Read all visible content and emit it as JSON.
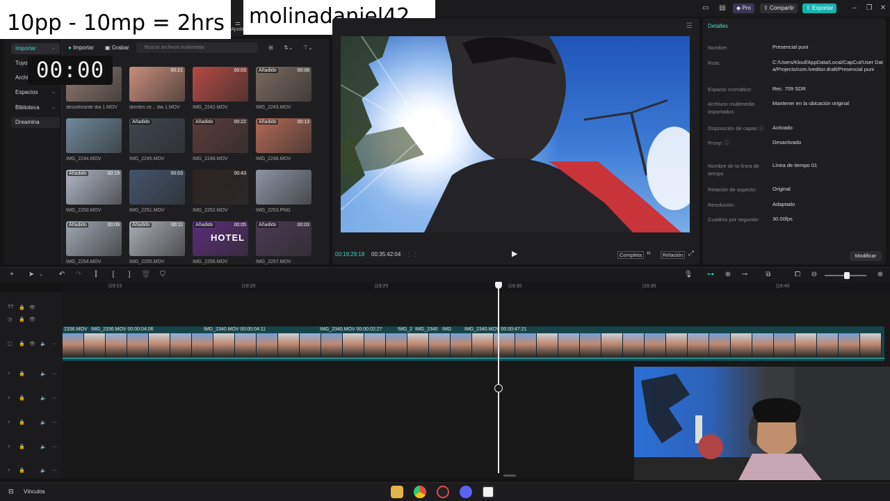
{
  "overlay": {
    "label": "10pp - 10mp = 2hrs",
    "username": "molinadaniel42",
    "timer": "00:00",
    "ajuste_label": "Ajuste"
  },
  "titlebar": {
    "pro_label": "Pro",
    "share_label": "Compartir",
    "export_label": "Exportar"
  },
  "media": {
    "sidebar": [
      {
        "label": "Importar",
        "has_chevron": true
      },
      {
        "label": "Tuyos",
        "has_chevron": false
      },
      {
        "label": "Archivos",
        "has_chevron": false
      },
      {
        "label": "Espacios",
        "has_chevron": true
      },
      {
        "label": "Biblioteca",
        "has_chevron": true
      },
      {
        "label": "Dreamina",
        "has_chevron": false
      }
    ],
    "import_label": "Importar",
    "record_label": "Grabar",
    "search_placeholder": "Buscar archivos multimedia",
    "tiles": [
      {
        "name": "desodorante dia 1.MOV",
        "badge": "",
        "duration": ""
      },
      {
        "name": "dientes ce... dia 1.MOV",
        "badge": "",
        "duration": "00:21"
      },
      {
        "name": "IMG_2242.MOV",
        "badge": "",
        "duration": "00:03"
      },
      {
        "name": "IMG_2243.MOV",
        "badge": "Añadido",
        "duration": "00:08"
      },
      {
        "name": "IMG_2244.MOV",
        "badge": "",
        "duration": ""
      },
      {
        "name": "IMG_2245.MOV",
        "badge": "Añadido",
        "duration": ""
      },
      {
        "name": "IMG_2246.MOV",
        "badge": "Añadido",
        "duration": "00:22"
      },
      {
        "name": "IMG_2248.MOV",
        "badge": "Añadido",
        "duration": "00:13"
      },
      {
        "name": "IMG_2250.MOV",
        "badge": "Añadido",
        "duration": "00:19"
      },
      {
        "name": "IMG_2251.MOV",
        "badge": "",
        "duration": "00:03"
      },
      {
        "name": "IMG_2252.MOV",
        "badge": "",
        "duration": "00:43"
      },
      {
        "name": "IMG_2253.PNG",
        "badge": "",
        "duration": ""
      },
      {
        "name": "IMG_2254.MOV",
        "badge": "Añadido",
        "duration": "00:09"
      },
      {
        "name": "IMG_2255.MOV",
        "badge": "Añadido",
        "duration": "00:11"
      },
      {
        "name": "IMG_2256.MOV",
        "badge": "Añadido",
        "duration": "00:05"
      },
      {
        "name": "IMG_2257.MOV",
        "badge": "Añadido",
        "duration": "00:03"
      }
    ],
    "tile_colors": [
      "#8f7a70",
      "#c98d7a",
      "#b64a44",
      "#7a6a60",
      "#6f8a9a",
      "#3f4650",
      "#5a3c3a",
      "#b26a55",
      "#b0b6c4",
      "#43546a",
      "#2c2422",
      "#8d95a3",
      "#9ea6b0",
      "#a7adb4",
      "#5a2d78",
      "#4a3a52"
    ],
    "hotel_text": "HOTEL"
  },
  "player": {
    "current_time": "00:19:29:18",
    "total_time": "00:35:42:04",
    "full_label": "Completa",
    "ratio_label": "Relación"
  },
  "details": {
    "title": "Detalles",
    "rows": [
      {
        "label": "Nombre:",
        "value": "Presencial puni"
      },
      {
        "label": "Ruta:",
        "value": "C:/Users/Klouf/AppData/Local/CapCut/User Data/Projects/com.lveditor.draft/Presencial puni"
      },
      {
        "label": "Espacio cromático:",
        "value": "Rec. 709 SDR"
      },
      {
        "label": "Archivos multimedia importados:",
        "value": "Mantener en la ubicación original"
      },
      {
        "label": "Disposición de capas ⓘ",
        "value": "Activado"
      },
      {
        "label": "Proxy: ⓘ",
        "value": "Desactivado"
      },
      {
        "label": "Nombre de la línea de tiempo",
        "value": "Línea de tiempo 01"
      },
      {
        "label": "Relación de aspecto:",
        "value": "Original"
      },
      {
        "label": "Resolución:",
        "value": "Adaptado"
      },
      {
        "label": "Cuadros por segundo:",
        "value": "30.00fps"
      }
    ],
    "modify_label": "Modificar"
  },
  "timeline": {
    "ticks": [
      "|19:15",
      "|19:20",
      "|19:25",
      "|19:30",
      "|19:35",
      "|19:40"
    ],
    "clips": [
      {
        "label": "2336.MOV"
      },
      {
        "label": "IMG_2336.MOV  00:00:04:06"
      },
      {
        "label": "IMG_2340.MOV  00:00:04:11"
      },
      {
        "label": "IMG_2340.MOV  00:00:02:27"
      },
      {
        "label": "IMG_2"
      },
      {
        "label": "IMG_2340"
      },
      {
        "label": "IMG"
      },
      {
        "label": "IMG_2340.MOV  00:00:47:21"
      }
    ]
  },
  "taskbar": {
    "item_label": "Vínculos"
  },
  "colors": {
    "accent_teal": "#3ed4c6",
    "export_button": "#17b3b0",
    "clip_strip": "#16444a"
  }
}
